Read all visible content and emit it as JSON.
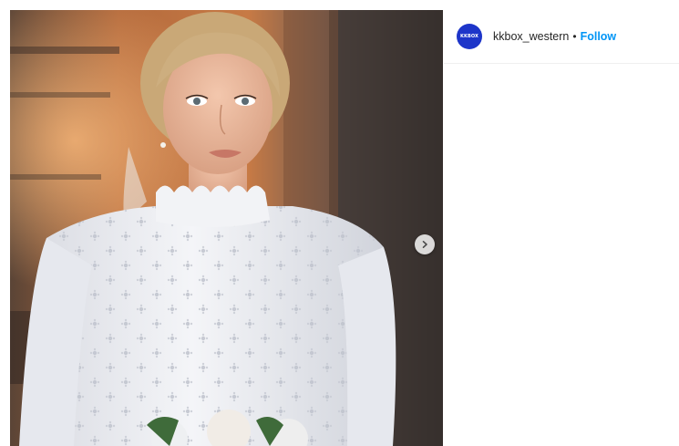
{
  "post": {
    "account": {
      "username": "kkbox_western",
      "avatar_text": "KKBOX",
      "avatar_color": "#1d35c9"
    },
    "separator": "•",
    "follow_label": "Follow",
    "follow_color": "#0095f6"
  },
  "media": {
    "next_icon": "chevron-right-icon"
  }
}
